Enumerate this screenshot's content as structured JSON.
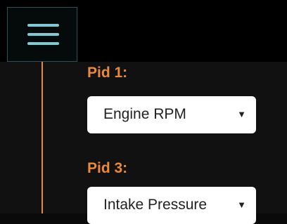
{
  "colors": {
    "menu_icon": "#7ecbd3",
    "accent_orange": "#e98a3a",
    "background": "#111111",
    "topbar": "#000000"
  },
  "header": {
    "menu_icon": "hamburger-menu-icon"
  },
  "pids": [
    {
      "label": "Pid 1:",
      "selected": "Engine RPM"
    },
    {
      "label": "Pid 3:",
      "selected": "Intake Pressure"
    }
  ],
  "icons": {
    "dropdown": "▼"
  }
}
